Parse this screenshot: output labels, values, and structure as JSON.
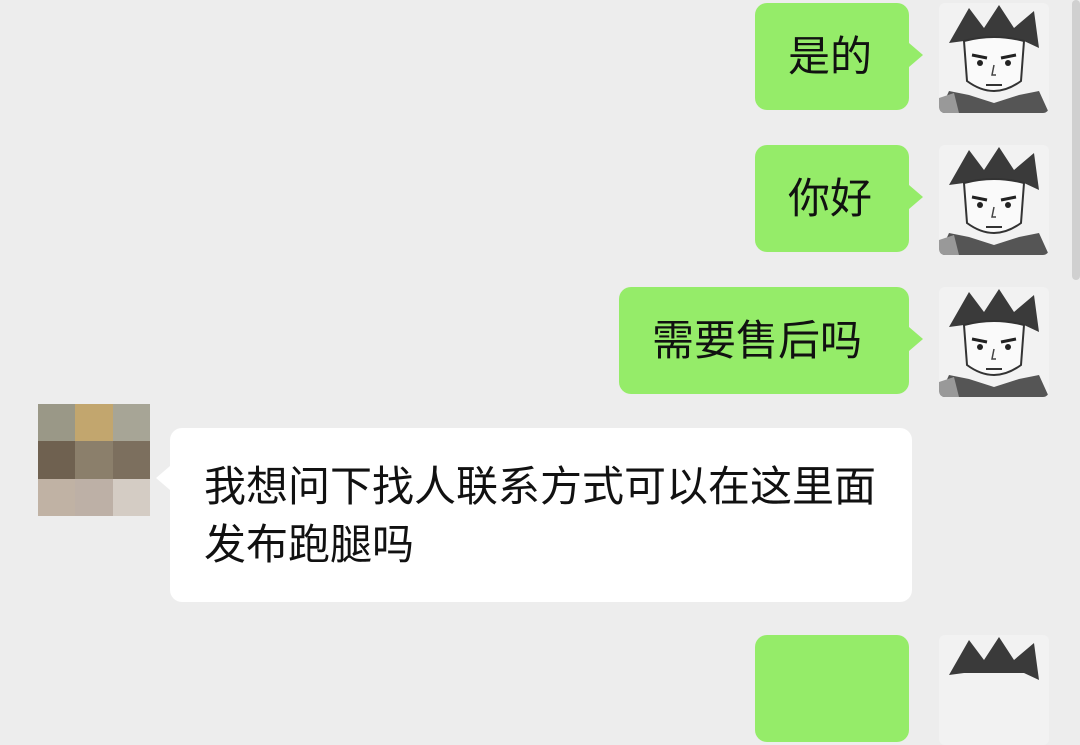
{
  "messages": [
    {
      "side": "out",
      "text": "是的"
    },
    {
      "side": "out",
      "text": "你好"
    },
    {
      "side": "out",
      "text": "需要售后吗"
    },
    {
      "side": "in",
      "text": "我想问下找人联系方式可以在这里面发布跑腿吗"
    },
    {
      "side": "out",
      "text": ""
    }
  ],
  "colors": {
    "background": "#ededed",
    "outgoing_bubble": "#95ec69",
    "incoming_bubble": "#ffffff",
    "text": "#111111"
  },
  "avatars": {
    "self": "anime-character-avatar-icon",
    "other": "pixelated-avatar-icon"
  },
  "mosaic_colors": [
    "#9a9887",
    "#c2a66e",
    "#a7a596",
    "#6f6150",
    "#8b7f6b",
    "#7c6f5e",
    "#c0b2a4",
    "#bdb0a6",
    "#d4ccc4"
  ]
}
